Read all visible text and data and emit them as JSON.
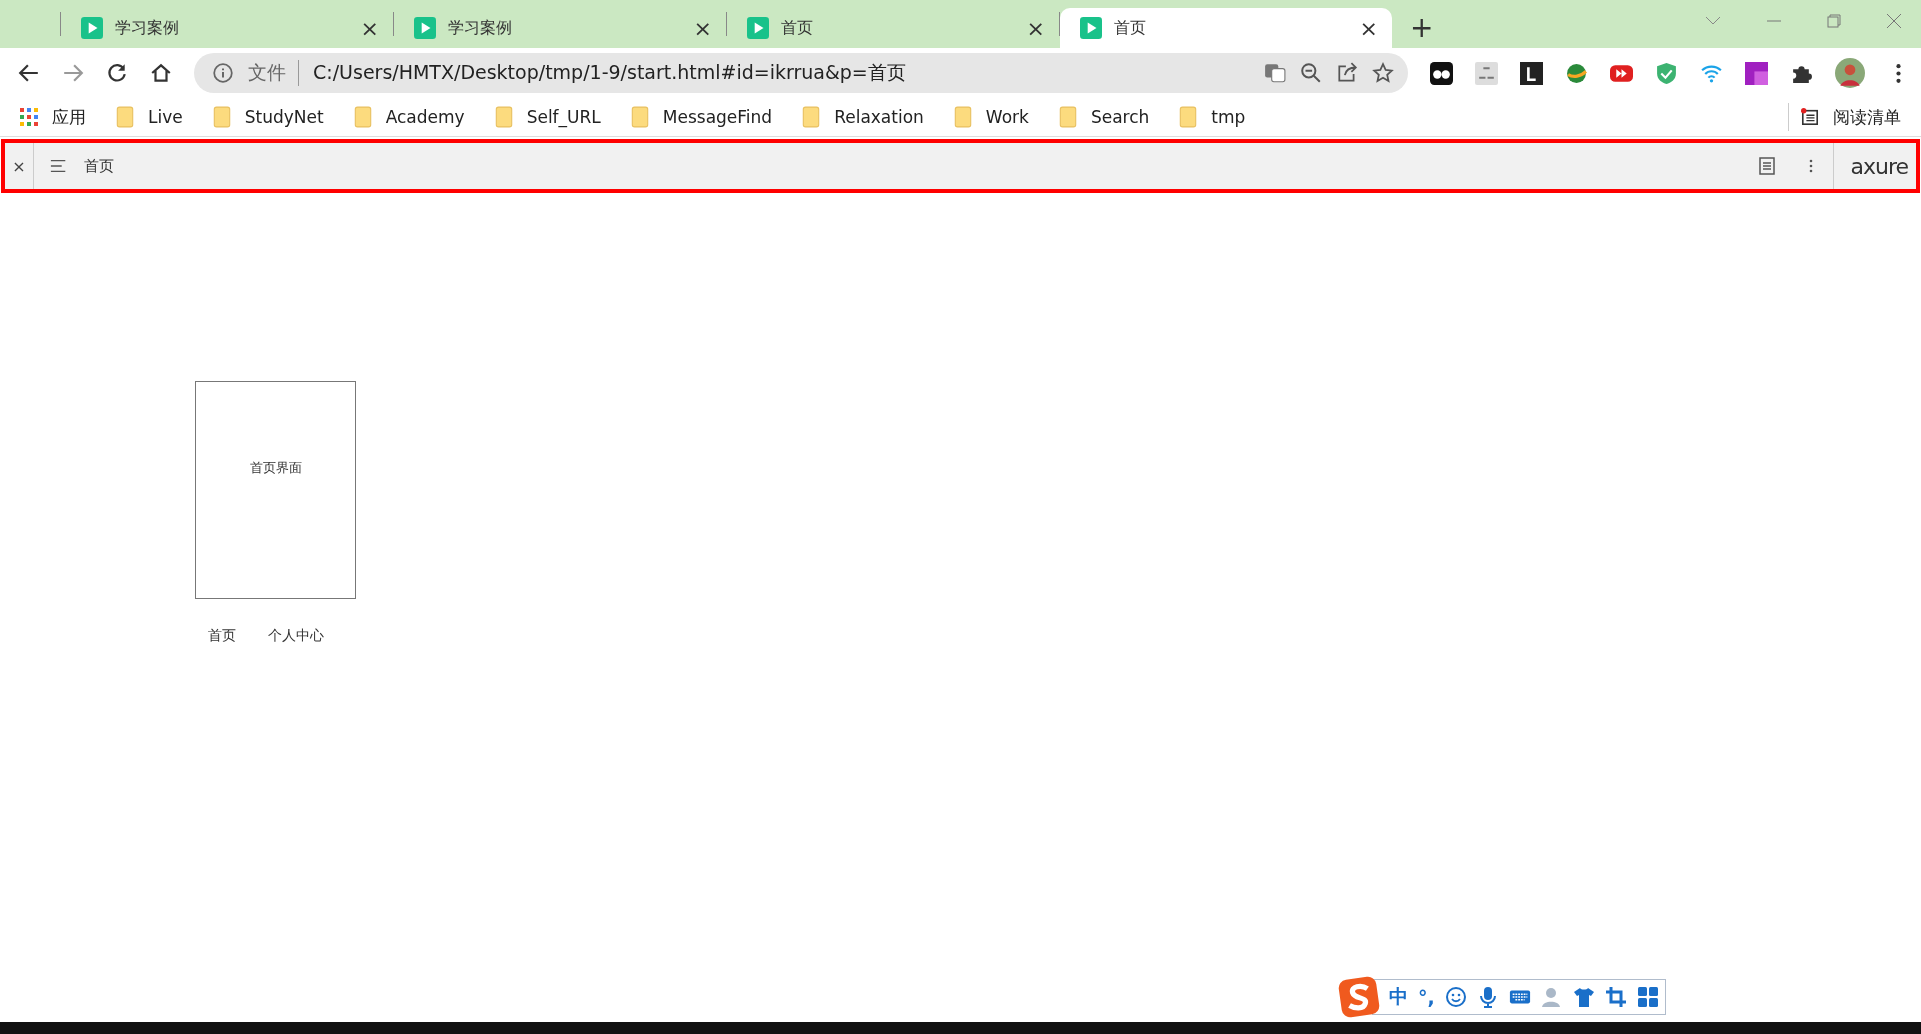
{
  "tabs": [
    {
      "title": "学习案例",
      "close": "×",
      "selected": false
    },
    {
      "title": "学习案例",
      "close": "×",
      "selected": false
    },
    {
      "title": "首页",
      "close": "×",
      "selected": false
    },
    {
      "title": "首页",
      "close": "×",
      "selected": true
    }
  ],
  "new_tab": "+",
  "address_bar": {
    "scheme_label": "文件",
    "url": "C:/Users/HMTX/Desktop/tmp/1-9/start.html#id=ikrrua&p=首页"
  },
  "bookmarks": {
    "apps": "应用",
    "folders": [
      "Live",
      "StudyNet",
      "Academy",
      "Self_URL",
      "MessageFind",
      "Relaxation",
      "Work",
      "Search",
      "tmp"
    ],
    "reading_list": "阅读清单"
  },
  "axure_toolbar": {
    "close": "×",
    "page_title": "首页",
    "logo": "axure"
  },
  "prototype": {
    "panel_text": "首页界面",
    "nav_links": [
      "首页",
      "个人中心"
    ]
  },
  "ime_toolbar": {
    "mode": "中",
    "punctuation": "°,"
  }
}
